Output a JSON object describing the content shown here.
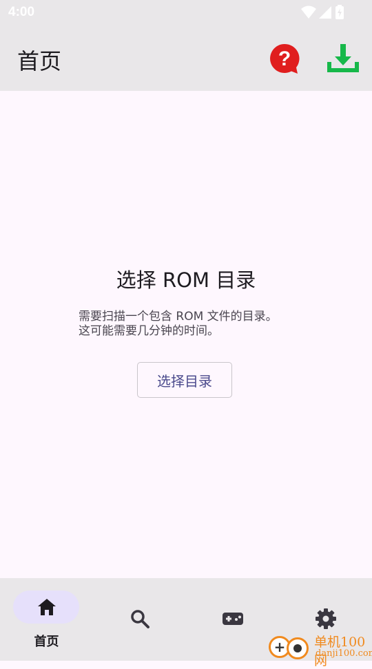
{
  "status_bar": {
    "time": "4:00",
    "icons": [
      "wifi-icon",
      "signal-icon",
      "battery-icon"
    ]
  },
  "app_bar": {
    "title": "首页",
    "actions": [
      {
        "name": "help",
        "icon": "help-icon",
        "color": "#e01e1e"
      },
      {
        "name": "download",
        "icon": "download-icon",
        "color": "#17b84a"
      }
    ]
  },
  "empty_state": {
    "title": "选择 ROM 目录",
    "description_line1": "需要扫描一个包含 ROM 文件的目录。",
    "description_line2": "这可能需要几分钟的时间。",
    "button_label": "选择目录"
  },
  "bottom_nav": {
    "items": [
      {
        "id": "home",
        "label": "首页",
        "icon": "home-icon",
        "selected": true
      },
      {
        "id": "search",
        "label": "",
        "icon": "search-icon",
        "selected": false
      },
      {
        "id": "games",
        "label": "",
        "icon": "gamepad-icon",
        "selected": false
      },
      {
        "id": "settings",
        "label": "",
        "icon": "gear-icon",
        "selected": false
      }
    ]
  },
  "watermark": {
    "text_cn": "单机100网",
    "text_url": "danji100.com"
  },
  "colors": {
    "background": "#fef7fe",
    "bar_background": "#e9e7e9",
    "nav_selected_pill": "#e6e0fb",
    "button_text": "#4a4a8c"
  }
}
